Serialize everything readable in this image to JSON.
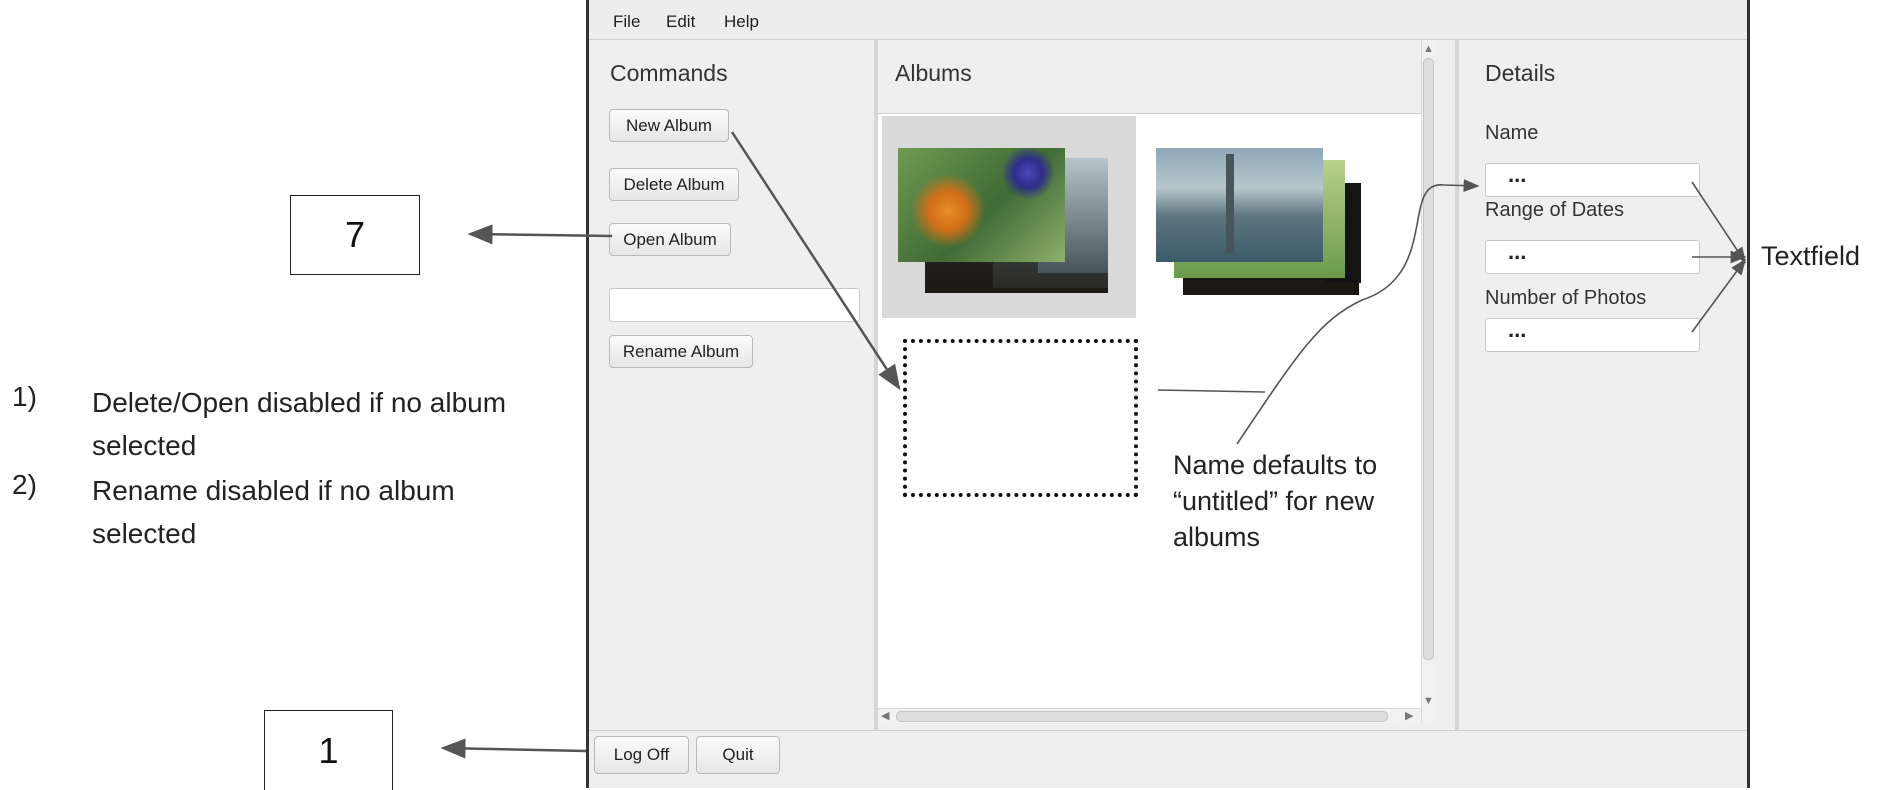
{
  "menu": {
    "file": "File",
    "edit": "Edit",
    "help": "Help"
  },
  "commands": {
    "title": "Commands",
    "new_album": "New Album",
    "delete_album": "Delete Album",
    "open_album": "Open Album",
    "rename_input_value": "",
    "rename_album": "Rename Album"
  },
  "albums": {
    "title": "Albums"
  },
  "details": {
    "title": "Details",
    "name_label": "Name",
    "name_value": "...",
    "dates_label": "Range of Dates",
    "dates_value": "...",
    "photos_label": "Number of Photos",
    "photos_value": "..."
  },
  "footer": {
    "log_off": "Log Off",
    "quit": "Quit"
  },
  "annotations": {
    "box_open": "7",
    "box_logoff": "1",
    "textfield_label": "Textfield",
    "new_album_note": "Name defaults to “untitled” for new albums",
    "rules": [
      {
        "num": "1)",
        "text": "Delete/Open disabled if no album selected"
      },
      {
        "num": "2)",
        "text": "Rename disabled if no album selected"
      }
    ]
  },
  "colors": {
    "window_bg": "#efefef",
    "selection_bg": "#d9d9d9",
    "annotation_line": "#555555"
  }
}
